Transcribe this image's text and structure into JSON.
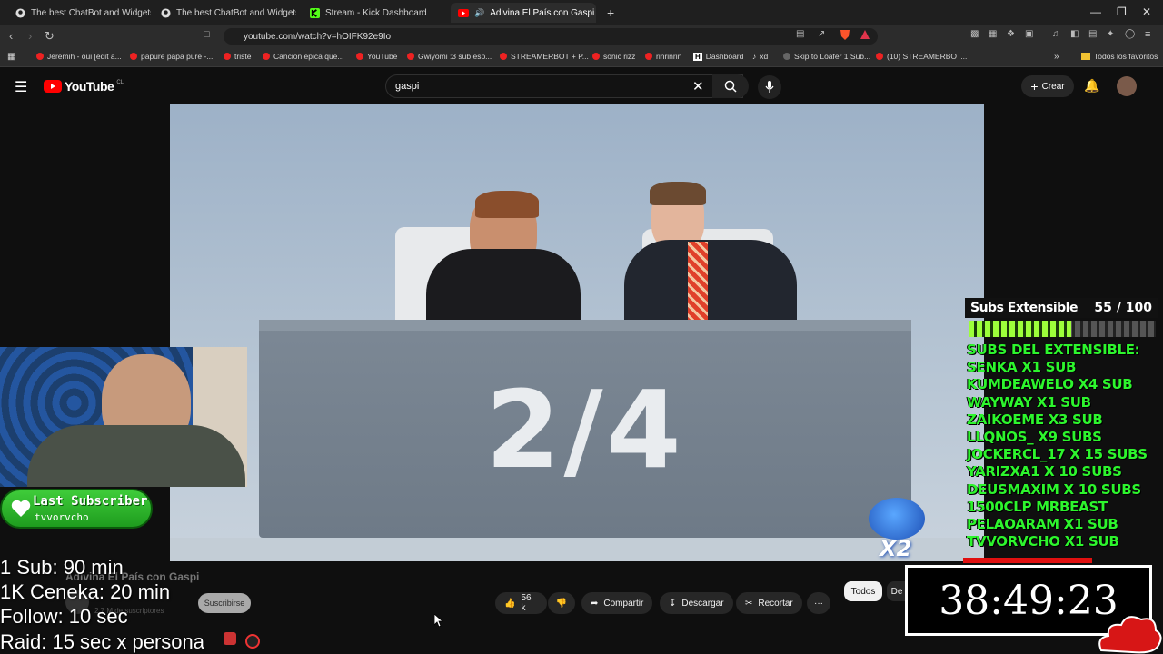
{
  "browser": {
    "tabs": [
      {
        "title": "The best ChatBot and Widgets for Ki",
        "icon": "github-icon",
        "active": false
      },
      {
        "title": "The best ChatBot and Widgets for Ki",
        "icon": "github-icon",
        "active": false
      },
      {
        "title": "Stream - Kick Dashboard",
        "icon": "kick-icon",
        "active": false
      },
      {
        "title": "Adivina El País con Gaspi - Yo",
        "icon": "youtube-icon",
        "active": true
      }
    ],
    "url": "youtube.com/watch?v=hOIFK92e9Io",
    "bookmarks": [
      "Jeremih - oui [edit a...",
      "papure papa pure -...",
      "triste",
      "Cancion epica que...",
      "YouTube",
      "Gwiyomi :3 sub esp...",
      "STREAMERBOT + P...",
      "sonic rizz",
      "rinrinrin",
      "Dashboard",
      "xd",
      "Skip to Loafer 1 Sub...",
      "(10) STREAMERBOT...",
      "Todos los favoritos"
    ]
  },
  "youtube": {
    "logo_text": "YouTube",
    "region": "CL",
    "search_value": "gaspi",
    "create_label": "Crear"
  },
  "video": {
    "overlay_text": "2/4",
    "title": "Adivina El País con Gaspi",
    "channel_subs": "2,7 M de suscriptores",
    "subscribe_label": "Suscribirse",
    "likes": "56 k",
    "share_label": "Compartir",
    "download_label": "Descargar",
    "clip_label": "Recortar",
    "more_label": "···",
    "chip_all": "Todos",
    "chip_partial": "De"
  },
  "stream_overlay": {
    "last_subscriber_title": "Last Subscriber",
    "last_subscriber_name": "tvvorvcho",
    "rules": [
      "1 Sub: 90 min",
      "1K Ceneka: 20 min",
      "Follow: 10 sec",
      "Raid: 15 sec x persona"
    ],
    "subs_panel": {
      "title": "Subs Extensible",
      "count": "55 / 100",
      "progress": 0.55,
      "header": "SUBS DEL EXTENSIBLE:",
      "entries": [
        "SENKA X1 SUB",
        "KUMDEAWELO X4 SUB",
        "WAYWAY X1 SUB",
        "ZAIKOEME X3 SUB",
        "LLQNOS_ X9 SUBS",
        "JOCKERCL_17 X 15 SUBS",
        "YARIZXA1 X 10 SUBS",
        "DEUSMAXIM X 10 SUBS",
        "1500CLP MRBEAST",
        "PELAOARAM X1 SUB",
        "TVVORVCHO X1 SUB"
      ]
    },
    "multiplier": "X2",
    "timer": "38:49:23"
  },
  "colors": {
    "subs_green": "#2df52d",
    "yt_red": "#ff0000"
  }
}
